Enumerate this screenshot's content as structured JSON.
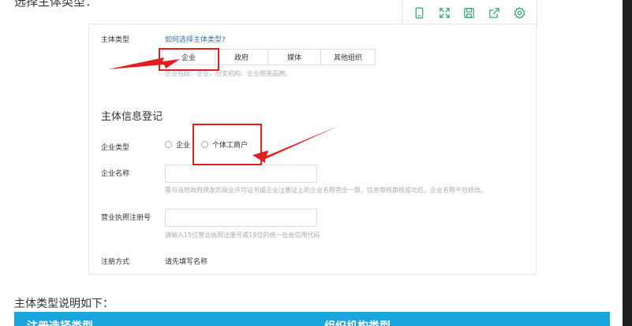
{
  "intro": "选择主体类型：",
  "toolbar": {
    "icons": [
      "mobile-preview-icon",
      "fullscreen-icon",
      "save-icon",
      "share-icon",
      "settings-icon"
    ],
    "accent": "#22a06b"
  },
  "form": {
    "subject_type_label": "主体类型",
    "help_link": "如何选择主体类型?",
    "tabs": [
      "企业",
      "政府",
      "媒体",
      "其他组织"
    ],
    "tab_hint": "企业包括：企业，分支机构、企业相关品牌。",
    "section_title": "主体信息登记",
    "enterprise_type_label": "企业类型",
    "radio_options": [
      "企业",
      "个体工商户"
    ],
    "enterprise_name_label": "企业名称",
    "enterprise_name_value": "",
    "enterprise_name_hint": "需与当地政府颁发的商业许可证书或企业注册证上的企业名称完全一致，信息审核审核成功后，企业名称不可修改。",
    "license_label": "营业执照注册号",
    "license_value": "",
    "license_hint": "请输入15位营业执照注册号或18位的统一社会信用代码",
    "register_method_label": "注册方式",
    "register_method_value": "请先填写名称"
  },
  "annotation_color": "#e02020",
  "footer": {
    "text": "主体类型说明如下：",
    "table_headers": [
      "注册选择类型",
      "组织机构类型"
    ],
    "table_header_color": "#1aa5dc"
  }
}
